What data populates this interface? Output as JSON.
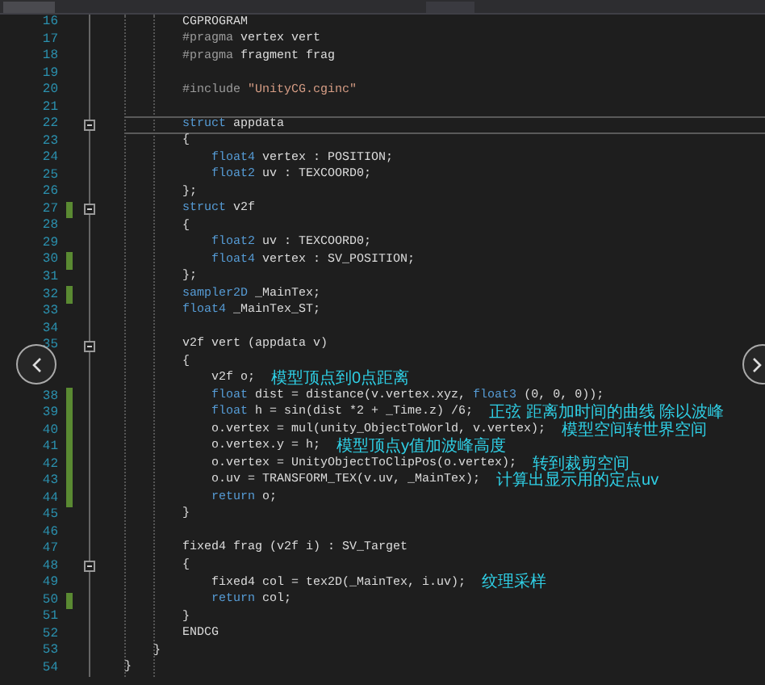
{
  "lines": [
    {
      "number": "16",
      "tokens": [
        {
          "kind": "plain",
          "text": "        CGPROGRAM"
        }
      ]
    },
    {
      "number": "17",
      "tokens": [
        {
          "kind": "directive",
          "text": "        #pragma"
        },
        {
          "kind": "plain",
          "text": " vertex vert"
        }
      ]
    },
    {
      "number": "18",
      "tokens": [
        {
          "kind": "directive",
          "text": "        #pragma"
        },
        {
          "kind": "plain",
          "text": " fragment frag"
        }
      ]
    },
    {
      "number": "19"
    },
    {
      "number": "20",
      "tokens": [
        {
          "kind": "directive",
          "text": "        #include "
        },
        {
          "kind": "string",
          "text": "\"UnityCG.cginc\""
        }
      ]
    },
    {
      "number": "21"
    },
    {
      "number": "22",
      "fold": true,
      "current": true,
      "tokens": [
        {
          "kind": "keyword",
          "text": "        struct"
        },
        {
          "kind": "plain",
          "text": " appdata"
        }
      ]
    },
    {
      "number": "23",
      "tokens": [
        {
          "kind": "plain",
          "text": "        {"
        }
      ]
    },
    {
      "number": "24",
      "tokens": [
        {
          "kind": "keyword",
          "text": "            float4"
        },
        {
          "kind": "plain",
          "text": " vertex : POSITION;"
        }
      ]
    },
    {
      "number": "25",
      "tokens": [
        {
          "kind": "keyword",
          "text": "            float2"
        },
        {
          "kind": "plain",
          "text": " uv : TEXCOORD0;"
        }
      ]
    },
    {
      "number": "26",
      "tokens": [
        {
          "kind": "plain",
          "text": "        };"
        }
      ]
    },
    {
      "number": "27",
      "fold": true,
      "changed": true,
      "tokens": [
        {
          "kind": "keyword",
          "text": "        struct"
        },
        {
          "kind": "plain",
          "text": " v2f"
        }
      ]
    },
    {
      "number": "28",
      "tokens": [
        {
          "kind": "plain",
          "text": "        {"
        }
      ]
    },
    {
      "number": "29",
      "tokens": [
        {
          "kind": "keyword",
          "text": "            float2"
        },
        {
          "kind": "plain",
          "text": " uv : TEXCOORD0;"
        }
      ]
    },
    {
      "number": "30",
      "changed": true,
      "tokens": [
        {
          "kind": "keyword",
          "text": "            float4"
        },
        {
          "kind": "plain",
          "text": " vertex : SV_POSITION;"
        }
      ]
    },
    {
      "number": "31",
      "tokens": [
        {
          "kind": "plain",
          "text": "        };"
        }
      ]
    },
    {
      "number": "32",
      "changed": true,
      "tokens": [
        {
          "kind": "keyword",
          "text": "        sampler2D"
        },
        {
          "kind": "plain",
          "text": " _MainTex;"
        }
      ]
    },
    {
      "number": "33",
      "tokens": [
        {
          "kind": "keyword",
          "text": "        float4"
        },
        {
          "kind": "plain",
          "text": " _MainTex_ST;"
        }
      ]
    },
    {
      "number": "34"
    },
    {
      "number": "35",
      "fold": true,
      "tokens": [
        {
          "kind": "plain",
          "text": "        v2f vert (appdata v)"
        }
      ]
    },
    {
      "tokens": [
        {
          "kind": "plain",
          "text": "        {"
        }
      ]
    },
    {
      "tokens": [
        {
          "kind": "plain",
          "text": "            v2f o;"
        }
      ],
      "note": "模型顶点到0点距离"
    },
    {
      "number": "38",
      "changed": true,
      "tokens": [
        {
          "kind": "keyword",
          "text": "            float"
        },
        {
          "kind": "plain",
          "text": " dist = distance(v.vertex.xyz, "
        },
        {
          "kind": "keyword",
          "text": "float3"
        },
        {
          "kind": "plain",
          "text": " (0, 0, 0));"
        }
      ]
    },
    {
      "number": "39",
      "changed": true,
      "tokens": [
        {
          "kind": "keyword",
          "text": "            float"
        },
        {
          "kind": "plain",
          "text": " h = sin(dist *2 + _Time.z) /6;"
        }
      ],
      "note": "正弦 距离加时间的曲线 除以波峰"
    },
    {
      "number": "40",
      "changed": true,
      "tokens": [
        {
          "kind": "plain",
          "text": "            o.vertex = mul(unity_ObjectToWorld, v.vertex);"
        }
      ],
      "note": "模型空间转世界空间"
    },
    {
      "number": "41",
      "changed": true,
      "tokens": [
        {
          "kind": "plain",
          "text": "            o.vertex.y = h;"
        }
      ],
      "note": "模型顶点y值加波峰高度"
    },
    {
      "number": "42",
      "changed": true,
      "tokens": [
        {
          "kind": "plain",
          "text": "            o.vertex = UnityObjectToClipPos(o.vertex);"
        }
      ],
      "note": "转到裁剪空间"
    },
    {
      "number": "43",
      "changed": true,
      "tokens": [
        {
          "kind": "plain",
          "text": "            o.uv = TRANSFORM_TEX(v.uv, _MainTex);"
        }
      ],
      "note": "计算出显示用的定点uv"
    },
    {
      "number": "44",
      "changed": true,
      "tokens": [
        {
          "kind": "keyword",
          "text": "            return"
        },
        {
          "kind": "plain",
          "text": " o;"
        }
      ]
    },
    {
      "number": "45",
      "tokens": [
        {
          "kind": "plain",
          "text": "        }"
        }
      ]
    },
    {
      "number": "46"
    },
    {
      "number": "47",
      "tokens": [
        {
          "kind": "plain",
          "text": "        fixed4 frag (v2f i) : SV_Target"
        }
      ]
    },
    {
      "number": "48",
      "fold": true,
      "tokens": [
        {
          "kind": "plain",
          "text": "        {"
        }
      ]
    },
    {
      "number": "49",
      "tokens": [
        {
          "kind": "plain",
          "text": "            fixed4 col = tex2D(_MainTex, i.uv);"
        }
      ],
      "note": "纹理采样"
    },
    {
      "number": "50",
      "changed": true,
      "tokens": [
        {
          "kind": "keyword",
          "text": "            return"
        },
        {
          "kind": "plain",
          "text": " col;"
        }
      ]
    },
    {
      "number": "51",
      "tokens": [
        {
          "kind": "plain",
          "text": "        }"
        }
      ]
    },
    {
      "number": "52",
      "tokens": [
        {
          "kind": "plain",
          "text": "        ENDCG"
        }
      ]
    },
    {
      "number": "53",
      "tokens": [
        {
          "kind": "plain",
          "text": "    }"
        }
      ]
    },
    {
      "number": "54",
      "tokens": [
        {
          "kind": "plain",
          "text": "}"
        }
      ]
    }
  ]
}
